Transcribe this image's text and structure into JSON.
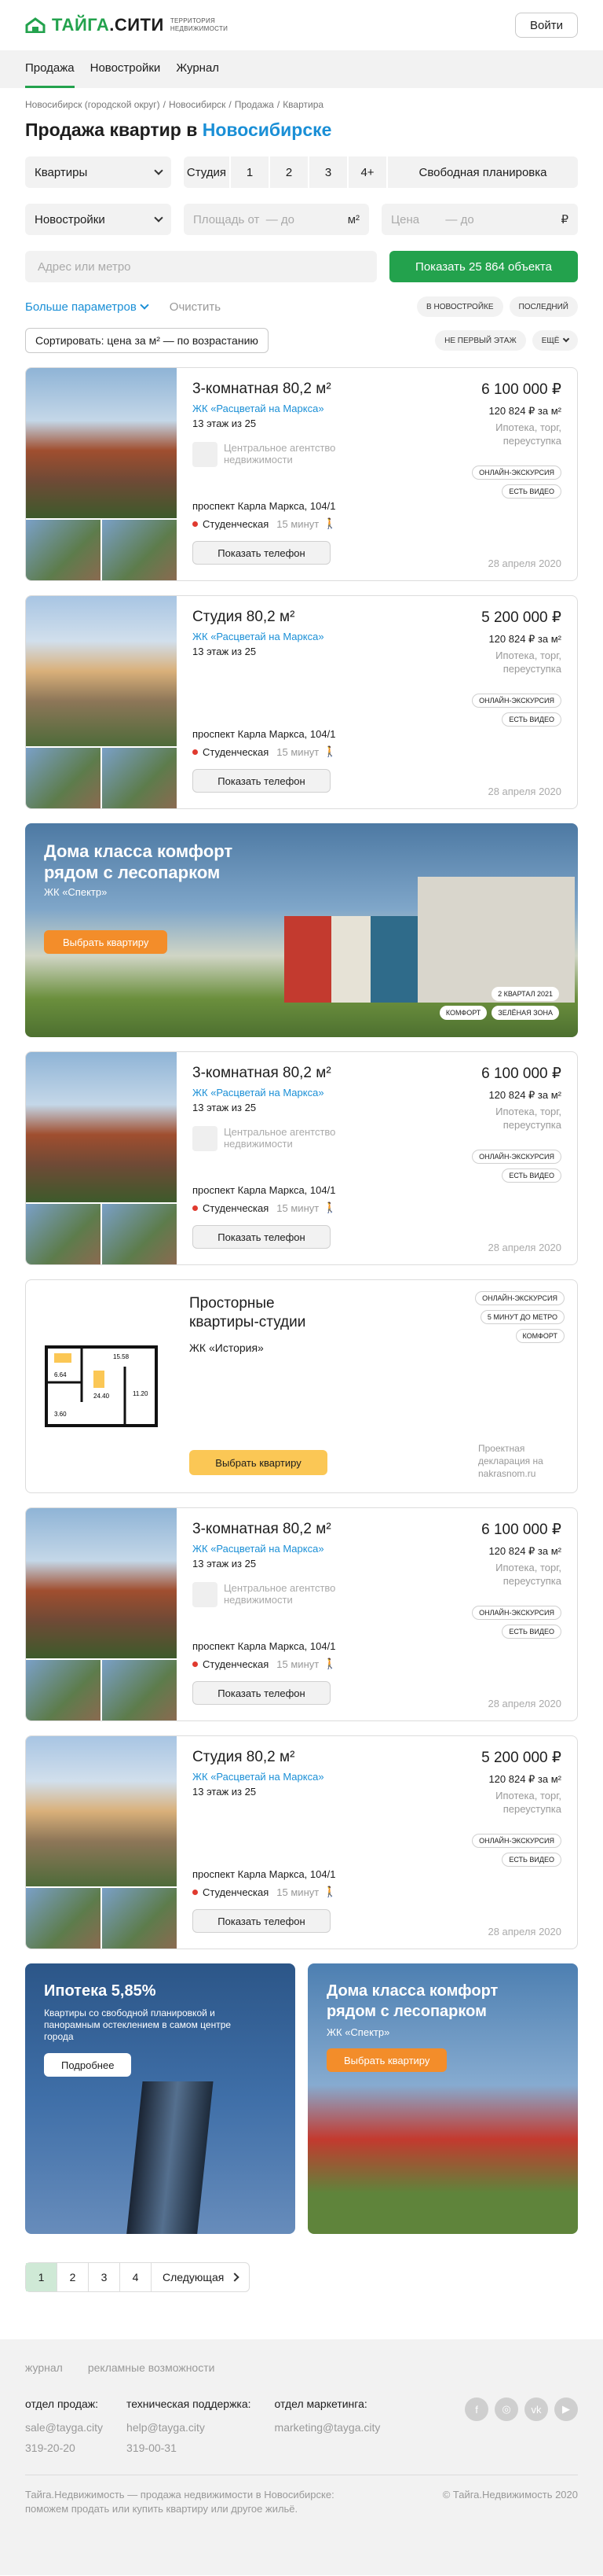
{
  "header": {
    "logo_a": "ТАЙГА",
    "logo_b": ".СИТИ",
    "logo_sub_1": "ТЕРРИТОРИЯ",
    "logo_sub_2": "НЕДВИЖИМОСТИ",
    "login": "Войти"
  },
  "nav": [
    "Продажа",
    "Новостройки",
    "Журнал"
  ],
  "breadcrumbs": [
    "Новосибирск (городской округ)",
    "/",
    "Новосибирск",
    "/",
    "Продажа",
    "/",
    "Квартира"
  ],
  "title": {
    "text": "Продажа квартир в",
    "city": "Новосибирске"
  },
  "filters": {
    "type": "Квартиры",
    "rooms": [
      "Студия",
      "1",
      "2",
      "3",
      "4+",
      "Свободная планировка"
    ],
    "market": "Новостройки",
    "area_from": "Площадь от",
    "area_to": "— до",
    "area_unit": "м²",
    "price": "Цена",
    "price_to": "— до",
    "price_unit": "₽",
    "address_placeholder": "Адрес или метро",
    "show_button": "Показать 25 864 объекта",
    "more": "Больше параметров",
    "clear": "Очистить",
    "tags_row1": [
      "В НОВОСТРОЙКЕ",
      "ПОСЛЕДНИЙ"
    ],
    "tags_row2": [
      "НЕ ПЕРВЫЙ ЭТАЖ",
      "ЕЩЁ"
    ],
    "sort": "Сортировать: цена за м² — по возрастанию"
  },
  "listings": [
    {
      "title": "3-комнатная 80,2 м²",
      "complex": "ЖК «Расцветай на Маркса»",
      "floor": "13 этаж из 25",
      "agency": "Центральное агентство недвижимости",
      "address": "проспект Карла Маркса, 104/1",
      "metro": "Студенческая",
      "mins": "15 минут",
      "phone": "Показать телефон",
      "price": "6 100 000 ₽",
      "per_m": "120 824 ₽ за м²",
      "terms": "Ипотека, торг, переуступка",
      "tags": [
        "ОНЛАЙН-ЭКСКУРСИЯ",
        "ЕСТЬ ВИДЕО"
      ],
      "date": "28 апреля 2020"
    },
    {
      "title": "Студия 80,2 м²",
      "complex": "ЖК «Расцветай на Маркса»",
      "floor": "13 этаж из 25",
      "agency": "",
      "address": "проспект Карла Маркса, 104/1",
      "metro": "Студенческая",
      "mins": "15 минут",
      "phone": "Показать телефон",
      "price": "5 200 000 ₽",
      "per_m": "120 824 ₽ за м²",
      "terms": "Ипотека, торг, переуступка",
      "tags": [
        "ОНЛАЙН-ЭКСКУРСИЯ",
        "ЕСТЬ ВИДЕО"
      ],
      "date": "28 апреля 2020"
    },
    {
      "title": "3-комнатная 80,2 м²",
      "complex": "ЖК «Расцветай на Маркса»",
      "floor": "13 этаж из 25",
      "agency": "Центральное агентство недвижимости",
      "address": "проспект Карла Маркса, 104/1",
      "metro": "Студенческая",
      "mins": "15 минут",
      "phone": "Показать телефон",
      "price": "6 100 000 ₽",
      "per_m": "120 824 ₽ за м²",
      "terms": "Ипотека, торг, переуступка",
      "tags": [
        "ОНЛАЙН-ЭКСКУРСИЯ",
        "ЕСТЬ ВИДЕО"
      ],
      "date": "28 апреля 2020"
    },
    {
      "title": "3-комнатная 80,2 м²",
      "complex": "ЖК «Расцветай на Маркса»",
      "floor": "13 этаж из 25",
      "agency": "Центральное агентство недвижимости",
      "address": "проспект Карла Маркса, 104/1",
      "metro": "Студенческая",
      "mins": "15 минут",
      "phone": "Показать телефон",
      "price": "6 100 000 ₽",
      "per_m": "120 824 ₽ за м²",
      "terms": "Ипотека, торг, переуступка",
      "tags": [
        "ОНЛАЙН-ЭКСКУРСИЯ",
        "ЕСТЬ ВИДЕО"
      ],
      "date": "28 апреля 2020"
    },
    {
      "title": "Студия 80,2 м²",
      "complex": "ЖК «Расцветай на Маркса»",
      "floor": "13 этаж из 25",
      "agency": "",
      "address": "проспект Карла Маркса, 104/1",
      "metro": "Студенческая",
      "mins": "15 минут",
      "phone": "Показать телефон",
      "price": "5 200 000 ₽",
      "per_m": "120 824 ₽ за м²",
      "terms": "Ипотека, торг, переуступка",
      "tags": [
        "ОНЛАЙН-ЭКСКУРСИЯ",
        "ЕСТЬ ВИДЕО"
      ],
      "date": "28 апреля 2020"
    }
  ],
  "banner1": {
    "title": "Дома класса комфорт рядом с лесопарком",
    "sub": "ЖК «Спектр»",
    "button": "Выбрать квартиру",
    "tags": [
      "2 КВАРТАЛ 2021",
      "КОМФОРТ",
      "ЗЕЛЁНАЯ ЗОНА"
    ]
  },
  "plan": {
    "title": "Просторные квартиры-студии",
    "sub": "ЖК «История»",
    "button": "Выбрать квартиру",
    "tags": [
      "ОНЛАЙН-ЭКСКУРСИЯ",
      "5 МИНУТ ДО МЕТРО",
      "КОМФОРТ"
    ],
    "note": "Проектная декларация на nakrasnom.ru",
    "labels": [
      "15.58",
      "6.64",
      "24.40",
      "11.20",
      "3.60"
    ]
  },
  "promo_mortgage": {
    "title": "Ипотека 5,85%",
    "desc": "Квартиры со свободной планировкой и панорамным остеклением в самом центре города",
    "button": "Подробнее"
  },
  "promo_comfort": {
    "title": "Дома класса комфорт рядом с лесопарком",
    "sub": "ЖК «Спектр»",
    "button": "Выбрать квартиру"
  },
  "pagination": {
    "pages": [
      "1",
      "2",
      "3",
      "4"
    ],
    "next": "Следующая"
  },
  "footer": {
    "links": [
      "журнал",
      "рекламные возможности"
    ],
    "sales": {
      "h": "отдел продаж:",
      "email": "sale@tayga.city",
      "phone": "319-20-20"
    },
    "support": {
      "h": "техническая поддержка:",
      "email": "help@tayga.city",
      "phone": "319-00-31"
    },
    "marketing": {
      "h": "отдел маркетинга:",
      "email": "marketing@tayga.city"
    },
    "socials": [
      "f",
      "◎",
      "vk",
      "▶"
    ],
    "about": "Тайга.Недвижимость — продажа недвижимости в Новосибирске: поможем продать или купить квартиру или другое жильё.",
    "copyright": "© Тайга.Недвижимость 2020"
  },
  "colors": {
    "brand": "#23a24d",
    "link": "#1a8fd6",
    "accent": "#f38d2a",
    "yellow": "#fbc755"
  }
}
